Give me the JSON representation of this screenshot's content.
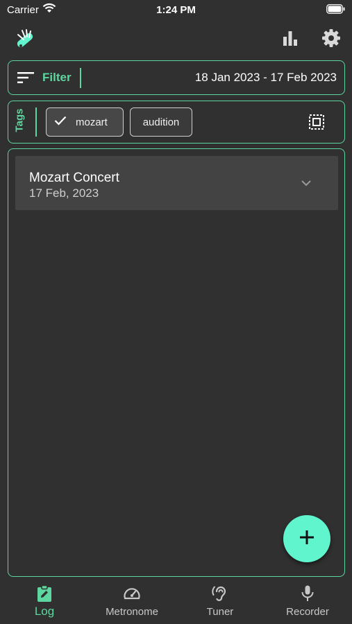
{
  "status_bar": {
    "carrier": "Carrier",
    "time": "1:24 PM"
  },
  "header": {
    "logo_icon": "swiss-knife-icon",
    "stats_icon": "bar-chart-icon",
    "settings_icon": "gear-icon"
  },
  "filter": {
    "label": "Filter",
    "date_range": "18 Jan 2023 - 17 Feb 2023"
  },
  "tags": {
    "label": "Tags",
    "chips": [
      {
        "label": "mozart",
        "selected": true
      },
      {
        "label": "audition",
        "selected": false
      }
    ]
  },
  "log": {
    "entries": [
      {
        "title": "Mozart Concert",
        "date": "17 Feb, 2023"
      }
    ]
  },
  "nav": {
    "items": [
      {
        "label": "Log",
        "icon": "clipboard-edit-icon",
        "active": true
      },
      {
        "label": "Metronome",
        "icon": "speedometer-icon",
        "active": false
      },
      {
        "label": "Tuner",
        "icon": "ear-icon",
        "active": false
      },
      {
        "label": "Recorder",
        "icon": "microphone-icon",
        "active": false
      }
    ]
  },
  "colors": {
    "accent": "#5ed69f",
    "fab": "#60f5cd",
    "background": "#303030",
    "card": "#434343"
  }
}
